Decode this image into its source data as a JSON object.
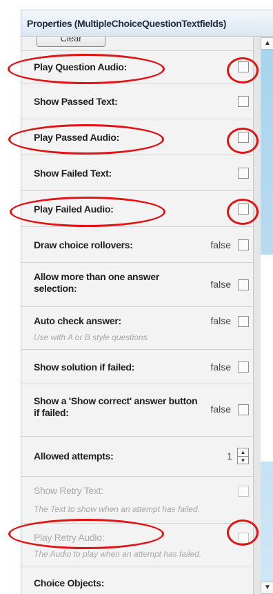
{
  "panel": {
    "title": "Properties (MultipleChoiceQuestionTextfields)",
    "clear_label": "Clear"
  },
  "rows": [
    {
      "label": "Play Question Audio:"
    },
    {
      "label": "Show Passed Text:"
    },
    {
      "label": "Play Passed Audio:"
    },
    {
      "label": "Show Failed Text:"
    },
    {
      "label": "Play Failed Audio:"
    },
    {
      "label": "Draw choice rollovers:",
      "value": "false"
    },
    {
      "label": "Allow more than one answer selection:",
      "value": "false"
    },
    {
      "label": "Auto check answer:",
      "value": "false",
      "hint": "Use with A or B style questions."
    },
    {
      "label": "Show solution if failed:",
      "value": "false"
    },
    {
      "label": "Show a 'Show correct' answer button if failed:",
      "value": "false"
    },
    {
      "label": "Allowed attempts:",
      "value": "1"
    },
    {
      "label": "Show Retry Text:",
      "hint": "The Text to show when an attempt has failed."
    },
    {
      "label": "Play Retry Audio:",
      "hint": "The Audio to play when an attempt has failed."
    },
    {
      "label": "Choice Objects:"
    }
  ],
  "icons": {
    "spinner_up": "▲",
    "spinner_down": "▼",
    "scroll_up": "▲",
    "scroll_down": "▼"
  },
  "annotation_color": "#e01414"
}
